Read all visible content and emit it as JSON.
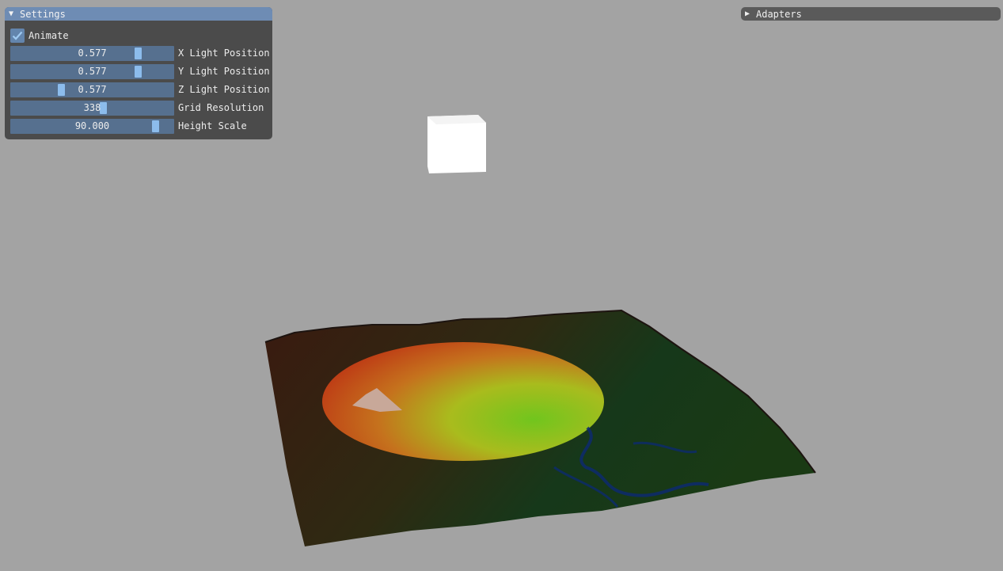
{
  "settings_panel": {
    "title": "Settings",
    "animate": {
      "label": "Animate",
      "checked": true
    },
    "sliders": [
      {
        "label": "X Light Position",
        "value": "0.577",
        "fraction": 0.8
      },
      {
        "label": "Y Light Position",
        "value": "0.577",
        "fraction": 0.8
      },
      {
        "label": "Z Light Position",
        "value": "0.577",
        "fraction": 0.3
      },
      {
        "label": "Grid Resolution",
        "value": "338",
        "fraction": 0.57
      },
      {
        "label": "Height Scale",
        "value": "90.000",
        "fraction": 0.91
      }
    ]
  },
  "adapters_panel": {
    "title": "Adapters",
    "collapsed": true
  },
  "colors": {
    "background": "#a3a3a3",
    "panel_bg": "#3c3c3c",
    "title_active": "#6e8cb4",
    "slider_bg": "#56708f",
    "slider_grab": "#8cbcec"
  }
}
